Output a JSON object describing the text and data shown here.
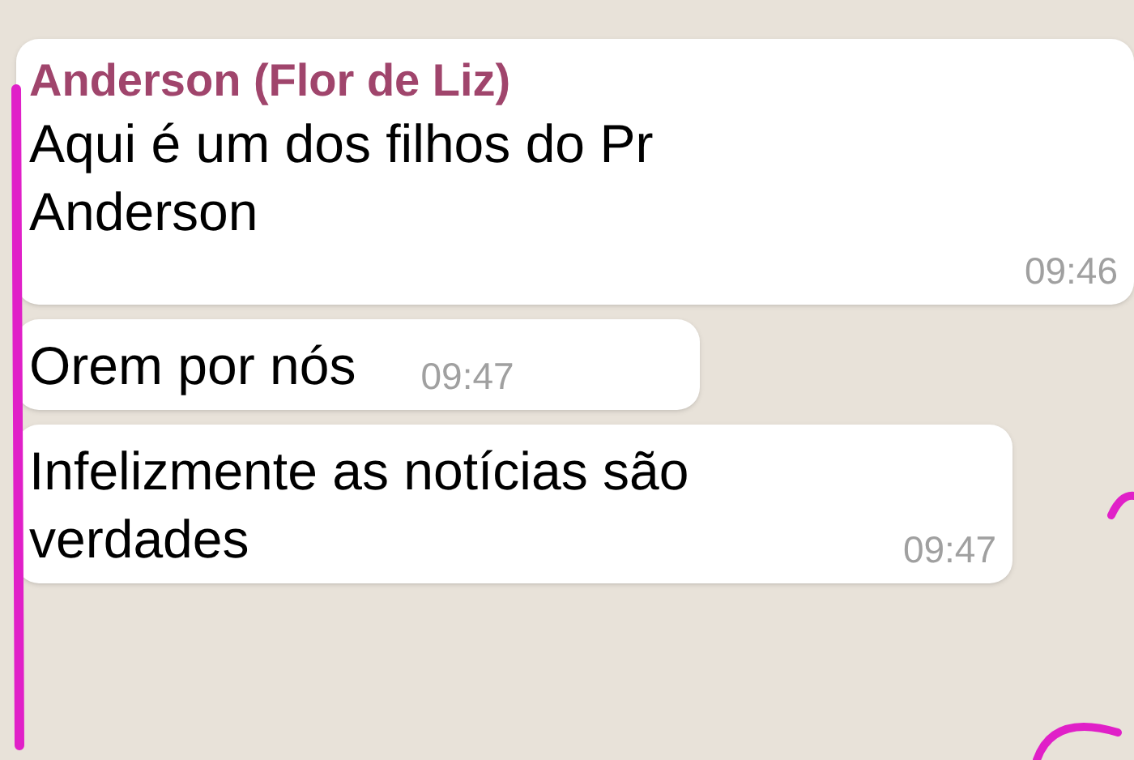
{
  "messages": [
    {
      "sender": "Anderson (Flor de Liz)",
      "text": "Aqui é um dos filhos do Pr Anderson",
      "time": "09:46"
    },
    {
      "text": "Orem por nós",
      "time": "09:47"
    },
    {
      "text": "Infelizmente as notícias são verdades",
      "time": "09:47"
    }
  ]
}
